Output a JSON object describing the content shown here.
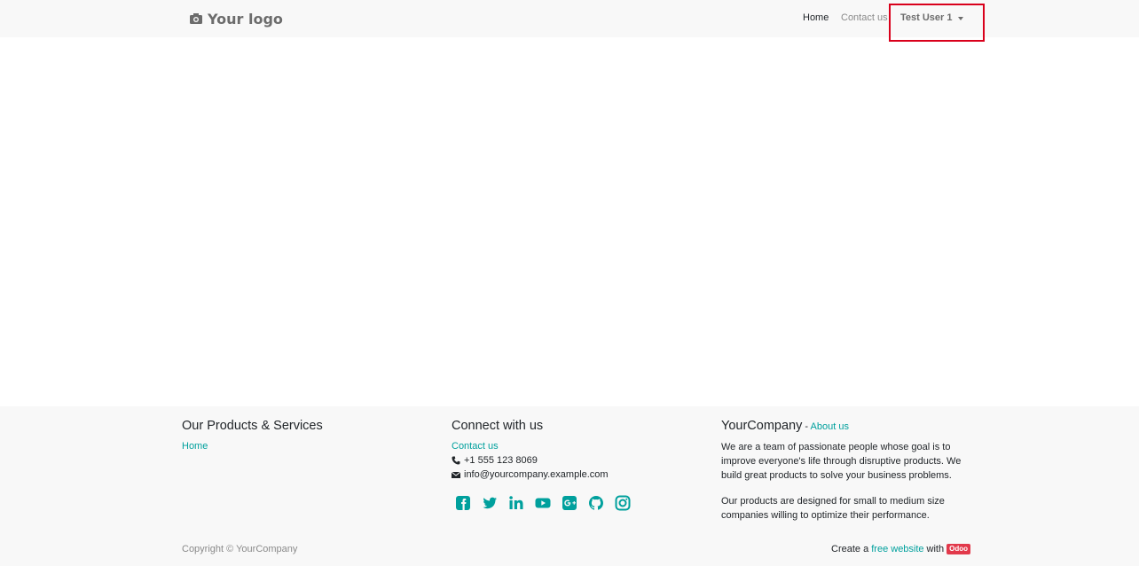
{
  "navbar": {
    "logo_text": "Your logo",
    "links": {
      "home": "Home",
      "contact": "Contact us"
    },
    "user_menu_label": "Test User 1"
  },
  "footer": {
    "products": {
      "heading": "Our Products & Services",
      "home_link": "Home"
    },
    "connect": {
      "heading": "Connect with us",
      "contact_link": "Contact us",
      "phone": "+1 555 123 8069",
      "email": "info@yourcompany.example.com",
      "socials": [
        "facebook-icon",
        "twitter-icon",
        "linkedin-icon",
        "youtube-icon",
        "google-plus-icon",
        "github-icon",
        "instagram-icon"
      ]
    },
    "about": {
      "company": "YourCompany",
      "separator": " - ",
      "about_link": "About us",
      "paragraph1": "We are a team of passionate people whose goal is to improve everyone's life through disruptive products. We build great products to solve your business problems.",
      "paragraph2": "Our products are designed for small to medium size companies willing to optimize their performance."
    },
    "copyright": "Copyright © YourCompany",
    "create": {
      "prefix": "Create a",
      "link": "free website",
      "suffix": "with",
      "badge": "Odoo"
    }
  },
  "colors": {
    "accent": "#00a09d",
    "highlight": "#d9001b",
    "badge": "#e2394b",
    "background_bar": "#f8f8f8"
  }
}
